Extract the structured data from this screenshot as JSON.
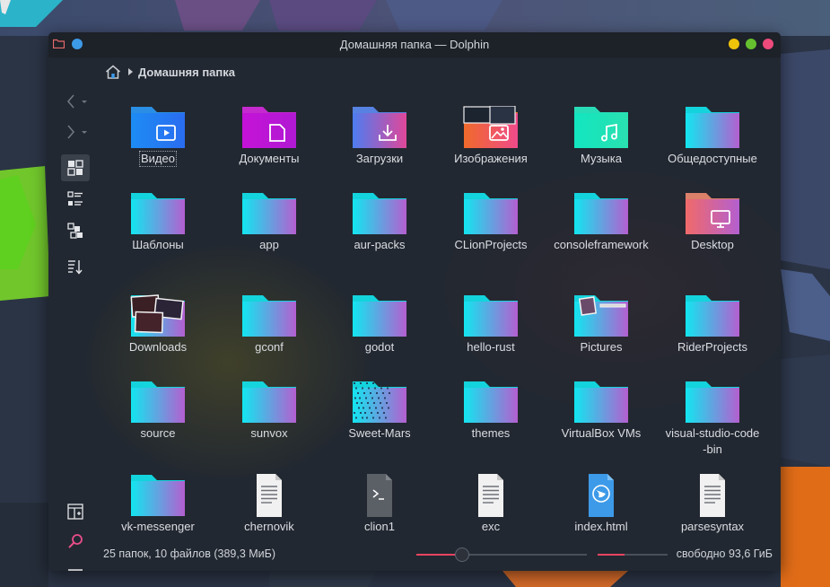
{
  "window": {
    "title": "Домашняя папка — Dolphin"
  },
  "breadcrumb": {
    "home_icon": "home-icon",
    "current": "Домашняя папка"
  },
  "colors": {
    "folder_gradient_start": "#12e6f0",
    "folder_gradient_end": "#b45fd0",
    "accent": "#ea4461",
    "window_bg": "#222831"
  },
  "items": [
    {
      "label": "Видео",
      "kind": "folder",
      "variant": "video"
    },
    {
      "label": "Документы",
      "kind": "folder",
      "variant": "documents"
    },
    {
      "label": "Загрузки",
      "kind": "folder",
      "variant": "downloads"
    },
    {
      "label": "Изображения",
      "kind": "folder",
      "variant": "pictures"
    },
    {
      "label": "Музыка",
      "kind": "folder",
      "variant": "music"
    },
    {
      "label": "Общедоступные",
      "kind": "folder",
      "variant": "plain"
    },
    {
      "label": "Шаблоны",
      "kind": "folder",
      "variant": "plain"
    },
    {
      "label": "app",
      "kind": "folder",
      "variant": "plain"
    },
    {
      "label": "aur-packs",
      "kind": "folder",
      "variant": "plain"
    },
    {
      "label": "CLionProjects",
      "kind": "folder",
      "variant": "plain"
    },
    {
      "label": "consoleframework",
      "kind": "folder",
      "variant": "plain"
    },
    {
      "label": "Desktop",
      "kind": "folder",
      "variant": "desktop"
    },
    {
      "label": "Downloads",
      "kind": "folder",
      "variant": "thumbs"
    },
    {
      "label": "gconf",
      "kind": "folder",
      "variant": "plain"
    },
    {
      "label": "godot",
      "kind": "folder",
      "variant": "plain"
    },
    {
      "label": "hello-rust",
      "kind": "folder",
      "variant": "plain"
    },
    {
      "label": "Pictures",
      "kind": "folder",
      "variant": "thumbs-small"
    },
    {
      "label": "RiderProjects",
      "kind": "folder",
      "variant": "plain"
    },
    {
      "label": "source",
      "kind": "folder",
      "variant": "plain"
    },
    {
      "label": "sunvox",
      "kind": "folder",
      "variant": "plain"
    },
    {
      "label": "Sweet-Mars",
      "kind": "folder",
      "variant": "pattern"
    },
    {
      "label": "themes",
      "kind": "folder",
      "variant": "plain"
    },
    {
      "label": "VirtualBox VMs",
      "kind": "folder",
      "variant": "plain"
    },
    {
      "label": "visual-studio-code-bin",
      "kind": "folder",
      "variant": "plain"
    },
    {
      "label": "vk-messenger",
      "kind": "folder",
      "variant": "plain"
    },
    {
      "label": "chernovik",
      "kind": "file",
      "variant": "text"
    },
    {
      "label": "clion1",
      "kind": "file",
      "variant": "script"
    },
    {
      "label": "exc",
      "kind": "file",
      "variant": "text"
    },
    {
      "label": "index.html",
      "kind": "file",
      "variant": "html"
    },
    {
      "label": "parsesyntax",
      "kind": "file",
      "variant": "text"
    }
  ],
  "status": {
    "summary": "25 папок, 10 файлов (389,3 МиБ)",
    "free_space": "свободно 93,6 ГиБ",
    "zoom_fraction": 0.27,
    "space_used_fraction": 0.38
  }
}
